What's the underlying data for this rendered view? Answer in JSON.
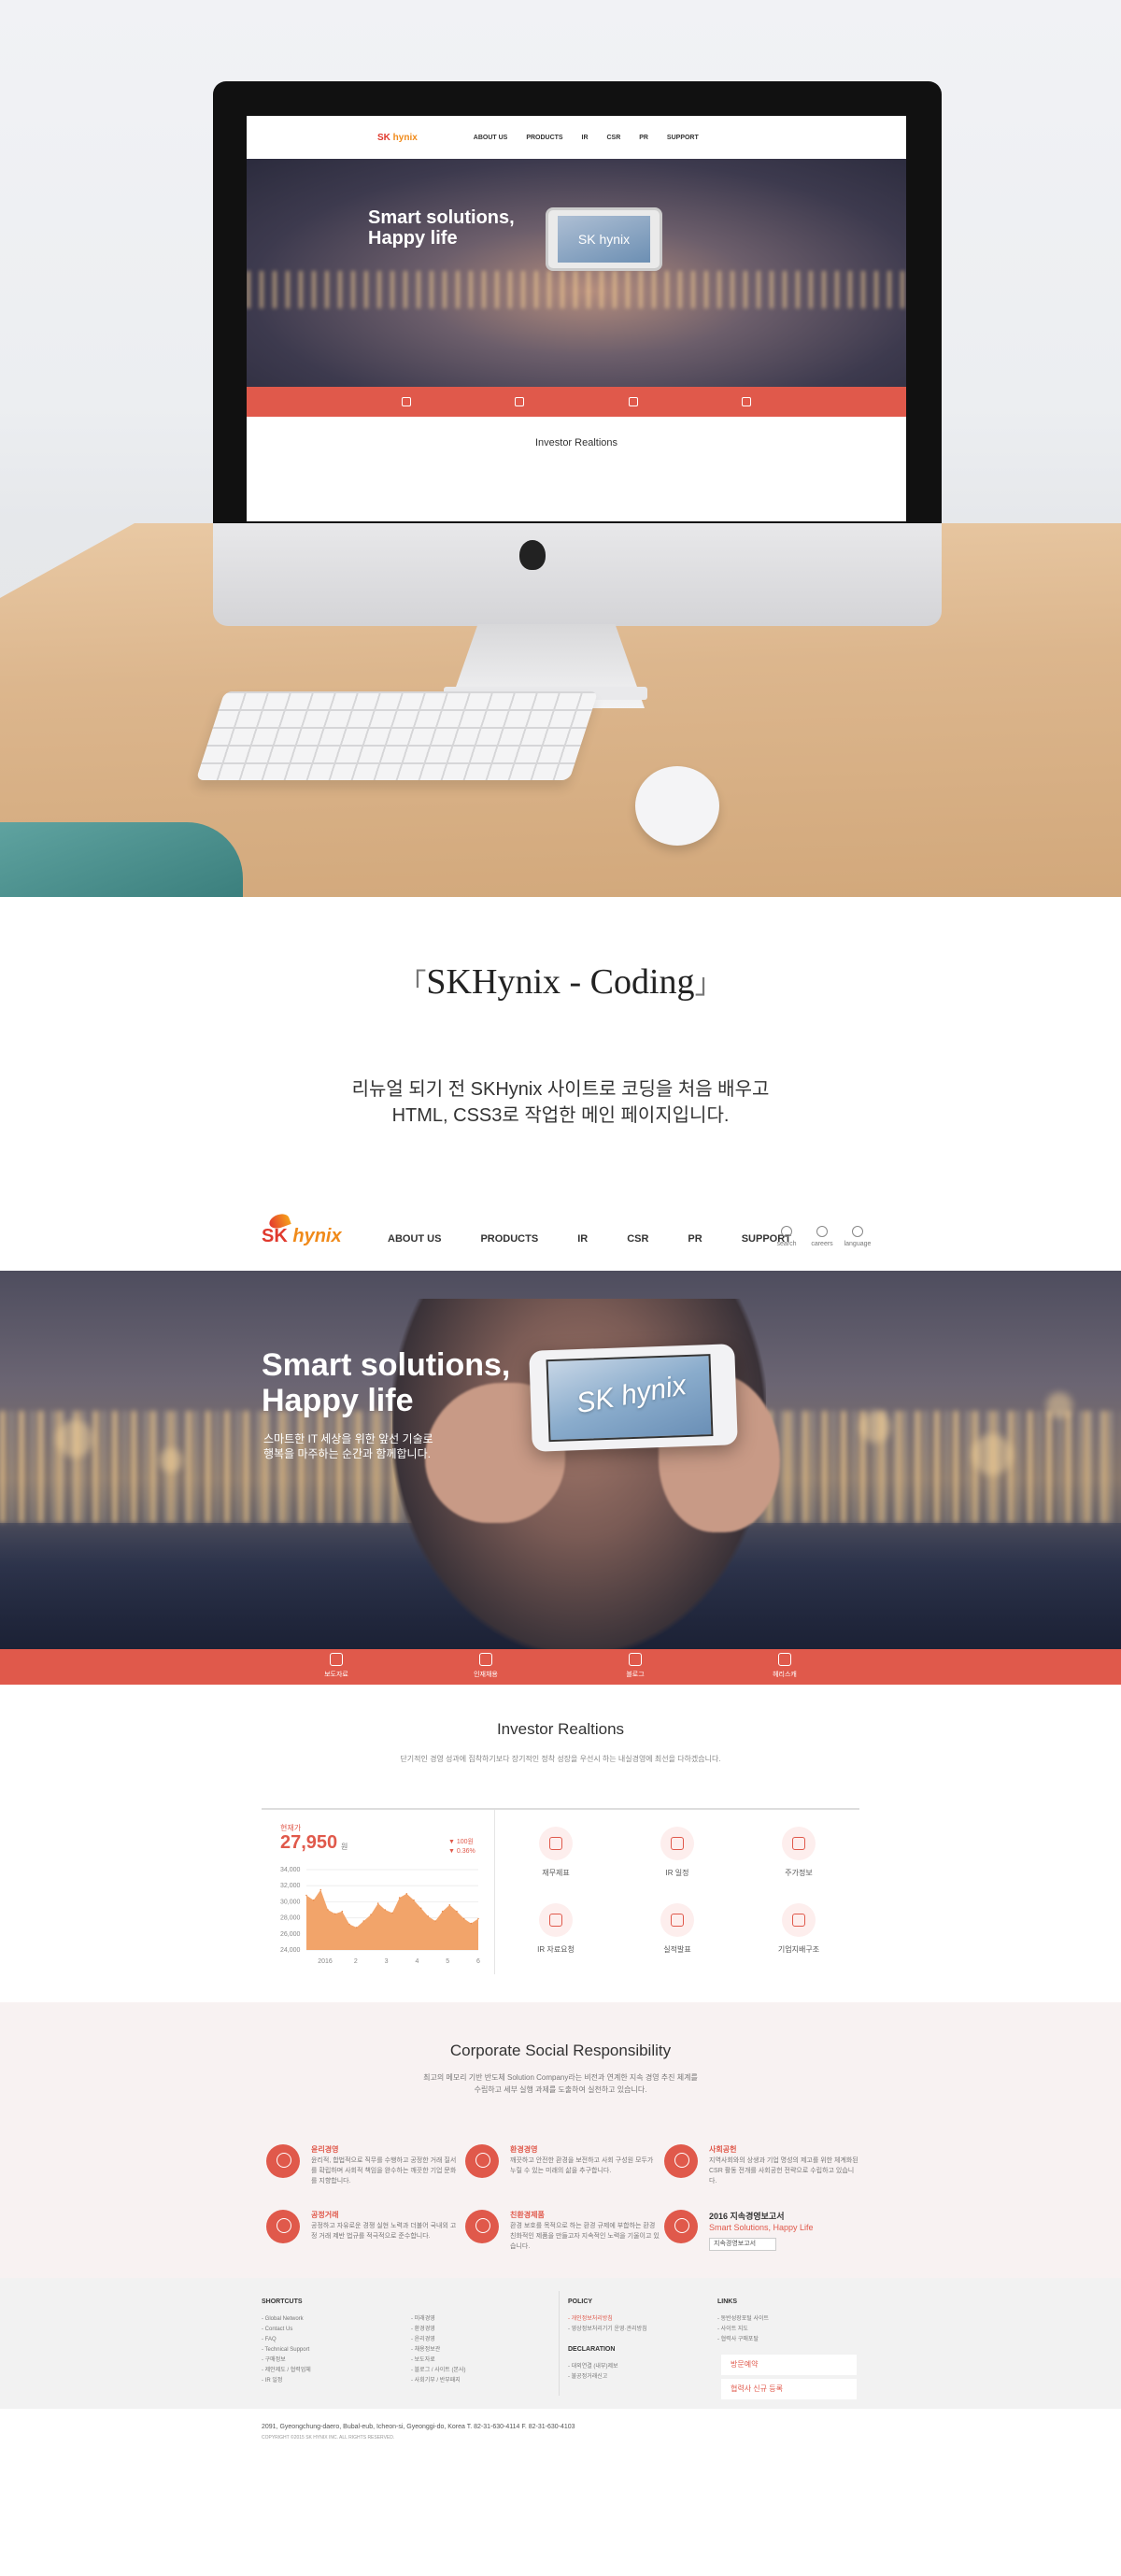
{
  "mockup": {
    "screen": {
      "nav": [
        "ABOUT US",
        "PRODUCTS",
        "IR",
        "CSR",
        "PR",
        "SUPPORT"
      ],
      "hero_title_line1": "Smart solutions,",
      "hero_title_line2": "Happy life",
      "phone_text": "SK hynix",
      "ir_title": "Investor Realtions"
    }
  },
  "caption": {
    "title": "SKHynix - Coding",
    "desc_line1": "리뉴얼 되기 전 SKHynix 사이트로 코딩을 처음 배우고",
    "desc_line2": "HTML, CSS3로 작업한 메인 페이지입니다."
  },
  "site": {
    "logo_sk": "SK",
    "logo_hynix": "hynix",
    "gnb": [
      "ABOUT US",
      "PRODUCTS",
      "IR",
      "CSR",
      "PR",
      "SUPPORT"
    ],
    "util": [
      "search",
      "careers",
      "language"
    ],
    "hero": {
      "title_line1": "Smart solutions,",
      "title_line2": "Happy life",
      "sub_line1": "스마트한 IT 세상을 위한 앞선 기술로",
      "sub_line2": "행복을 마주하는 순간과 함께합니다.",
      "phone_text": "SK hynix"
    },
    "quickbar": [
      "보도자료",
      "인재채용",
      "블로그",
      "헤리스캐"
    ],
    "ir": {
      "title": "Investor Realtions",
      "desc": "단기적인 경영 성과에 집착하기보다 장기적인 정착 성장을 우선시 하는 내실경영에 최선을 다하겠습니다.",
      "stock_label": "현재가",
      "stock_price": "27,950",
      "stock_unit": "원",
      "change_amount": "▼ 100원",
      "change_pct": "▼ 0.36%",
      "icons": [
        "재무제표",
        "IR 일정",
        "주가정보",
        "IR 자료요청",
        "실적발표",
        "기업지배구조"
      ]
    },
    "csr": {
      "title": "Corporate Social Responsibility",
      "desc_line1": "최고의 메모리 기반 반도체 Solution Company라는 비전과 연계한 지속 경영 추진 체계를",
      "desc_line2": "수립하고 세부 실행 과제를 도출하여 실천하고 있습니다.",
      "items": [
        {
          "title": "윤리경영",
          "text": "윤리적, 합법적으로 직무를 수행하고 공정한 거래 질서를 확립하며 사회적 책임을 완수하는 깨끗한 기업 문화를 지향합니다."
        },
        {
          "title": "환경경영",
          "text": "깨끗하고 안전한 환경을 보전하고 사회 구성원 모두가 누릴 수 있는 미래의 삶을 추구합니다."
        },
        {
          "title": "사회공헌",
          "text": "지역사회와의 상생과 기업 명성의 제고를 위한 체계화된 CSR 활동 전개를 사회공헌 전략으로 수립하고 있습니다."
        },
        {
          "title": "공정거래",
          "text": "공정하고 자유로운 경쟁 실현 노력과 더불어 국내외 고정 거래 제반 법규를 적극적으로 준수합니다."
        },
        {
          "title": "친환경제품",
          "text": "환경 보호를 목적으로 하는 환경 규제에 부합하는 환경친화적인 제품을 만들고자 지속적인 노력을 기울이고 있습니다."
        }
      ],
      "report_title": "2016 지속경영보고서",
      "report_sub": "Smart Solutions, Happy Life",
      "report_btn": "지속경영보고서"
    },
    "footer": {
      "shortcuts_head": "SHORTCUTS",
      "shortcuts_a": [
        "- Global Network",
        "- Contact Us",
        "- FAQ",
        "- Technical Support",
        "- 구매정보",
        "- 제안제도 / 협력업체",
        "- IR 일정"
      ],
      "shortcuts_b": [
        "- 미래경영",
        "- 환경경영",
        "- 윤리경영",
        "- 채용정보관",
        "- 보도자료",
        "- 블로그 / 사이트 (본사)",
        "- 사회기부 / 반부패지"
      ],
      "policy_head": "POLICY",
      "policy": [
        "- 개인정보처리방침",
        "- 영상정보처리기기 운영·관리방침"
      ],
      "declaration_head": "DECLARATION",
      "declaration": [
        "- 대외연결 (내부)제보",
        "- 불공정거래신고"
      ],
      "links_head": "LINKS",
      "links": [
        "- 동반성장포털 사이트",
        "- 사이트 지도",
        "- 협력사 구매포탈"
      ],
      "banner1": "방문예약",
      "banner2": "협력사 신규 등록"
    },
    "address": "2091, Gyeongchung-daero, Bubal-eub, Icheon-si, Gyeonggi-do, Korea    T. 82-31-630-4114    F. 82-31-630-4103",
    "copyright": "COPYRIGHT ©2015 SK HYNIX INC. ALL RIGHTS RESERVED."
  },
  "chart_data": {
    "type": "area",
    "x_labels": [
      "2016",
      "2",
      "3",
      "4",
      "5",
      "6"
    ],
    "y_ticks": [
      "34,000",
      "32,000",
      "30,000",
      "28,000",
      "26,000",
      "24,000"
    ],
    "ylim": [
      24000,
      34000
    ],
    "values": [
      30800,
      30200,
      31500,
      29000,
      28500,
      28800,
      27200,
      26800,
      27600,
      28400,
      29800,
      29000,
      28600,
      30500,
      31000,
      30200,
      29200,
      28200,
      27600,
      28800,
      29600,
      28800,
      27900,
      27300,
      27900
    ],
    "color": "#f2a46a"
  }
}
